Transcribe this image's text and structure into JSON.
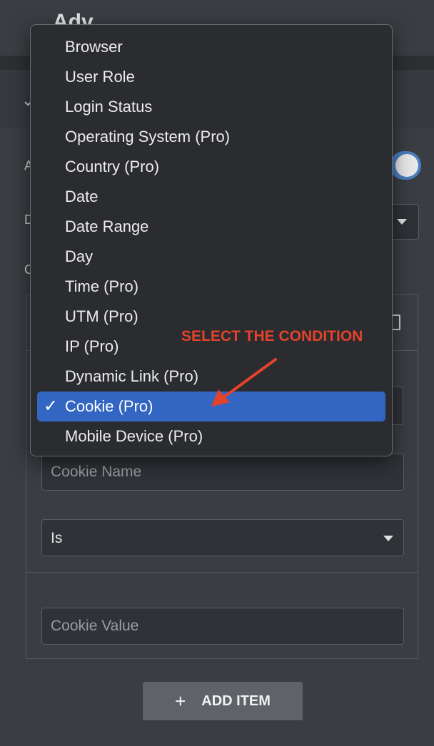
{
  "header": {
    "title_fragment": "Adv"
  },
  "background_fields": {
    "field_a_label_fragment": "A",
    "field_d_label_fragment": "D",
    "field_c_label_fragment": "C"
  },
  "dropdown": {
    "items": [
      {
        "label": "Browser",
        "selected": false
      },
      {
        "label": "User Role",
        "selected": false
      },
      {
        "label": "Login Status",
        "selected": false
      },
      {
        "label": "Operating System (Pro)",
        "selected": false
      },
      {
        "label": "Country (Pro)",
        "selected": false
      },
      {
        "label": "Date",
        "selected": false
      },
      {
        "label": "Date Range",
        "selected": false
      },
      {
        "label": "Day",
        "selected": false
      },
      {
        "label": "Time (Pro)",
        "selected": false
      },
      {
        "label": "UTM (Pro)",
        "selected": false
      },
      {
        "label": "IP (Pro)",
        "selected": false
      },
      {
        "label": "Dynamic Link (Pro)",
        "selected": false
      },
      {
        "label": "Cookie (Pro)",
        "selected": true
      },
      {
        "label": "Mobile Device (Pro)",
        "selected": false
      }
    ],
    "check_mark": "✓"
  },
  "annotation": {
    "text": "SELECT THE CONDITION",
    "color": "#e2432a"
  },
  "form": {
    "cookie_name": {
      "placeholder": "Cookie Name",
      "value": ""
    },
    "operator": {
      "value": "Is"
    },
    "cookie_value": {
      "placeholder": "Cookie Value",
      "value": ""
    }
  },
  "add_item": {
    "icon": "+",
    "label": "ADD ITEM"
  },
  "colors": {
    "selected_highlight": "#3366c2",
    "toggle_on": "#4a7fc1"
  }
}
